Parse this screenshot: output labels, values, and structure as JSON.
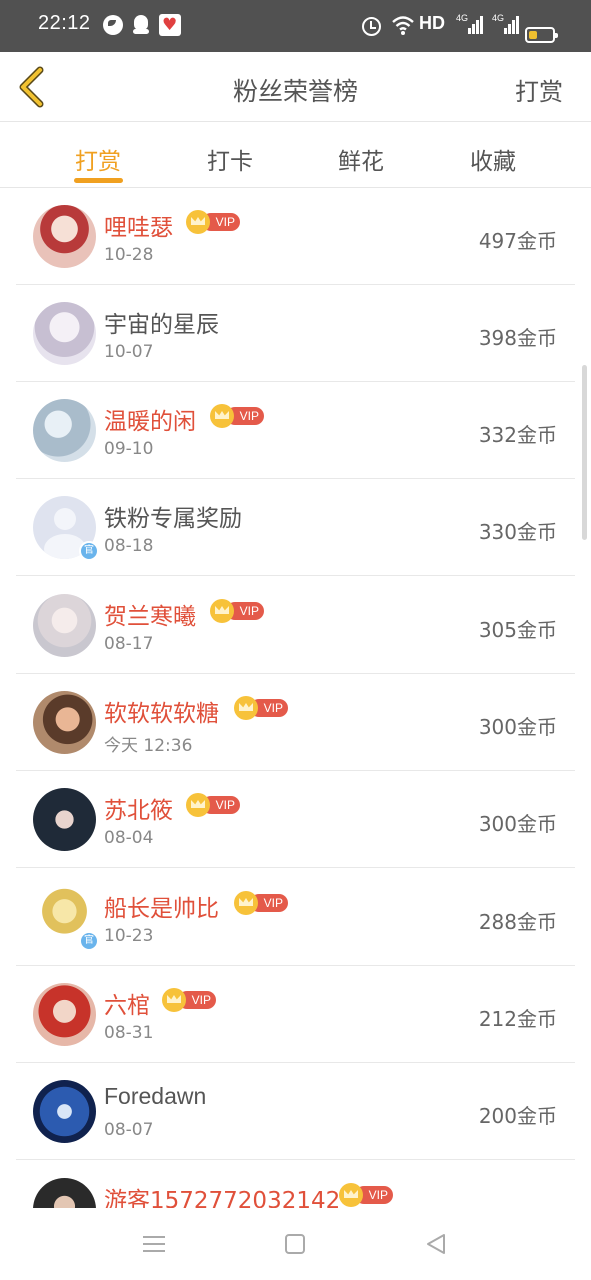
{
  "status_bar": {
    "time": "22:12",
    "hd_label": "HD",
    "network_label_1": "4G",
    "network_label_2": "4G"
  },
  "header": {
    "title": "粉丝荣誉榜",
    "reward_label": "打赏"
  },
  "tabs": [
    {
      "label": "打赏",
      "active": true
    },
    {
      "label": "打卡",
      "active": false
    },
    {
      "label": "鲜花",
      "active": false
    },
    {
      "label": "收藏",
      "active": false
    }
  ],
  "vip_label": "VIP",
  "official_label": "官",
  "colors": {
    "accent": "#f0a020",
    "vip_name": "#e0503a",
    "vip_badge": "#e45a4a",
    "crown": "#f7c23a",
    "status_bar_bg": "#515151"
  },
  "fans": [
    {
      "name": "哩哇瑟",
      "date": "10-28",
      "coins": "497金币",
      "vip": true,
      "official": false
    },
    {
      "name": "宇宙的星辰",
      "date": "10-07",
      "coins": "398金币",
      "vip": false,
      "official": false
    },
    {
      "name": "温暖的闲",
      "date": "09-10",
      "coins": "332金币",
      "vip": true,
      "official": false
    },
    {
      "name": "铁粉专属奖励",
      "date": "08-18",
      "coins": "330金币",
      "vip": false,
      "official": true
    },
    {
      "name": "贺兰寒曦",
      "date": "08-17",
      "coins": "305金币",
      "vip": true,
      "official": false
    },
    {
      "name": "软软软软糖",
      "date": "今天 12:36",
      "coins": "300金币",
      "vip": true,
      "official": false
    },
    {
      "name": "苏北筱",
      "date": "08-04",
      "coins": "300金币",
      "vip": true,
      "official": false
    },
    {
      "name": "船长是帅比",
      "date": "10-23",
      "coins": "288金币",
      "vip": true,
      "official": true
    },
    {
      "name": "六棺",
      "date": "08-31",
      "coins": "212金币",
      "vip": true,
      "official": false
    },
    {
      "name": "Foredawn",
      "date": "08-07",
      "coins": "200金币",
      "vip": false,
      "official": false
    },
    {
      "name": "游客1572772032142",
      "date": "",
      "coins": "",
      "vip": true,
      "official": false
    }
  ]
}
